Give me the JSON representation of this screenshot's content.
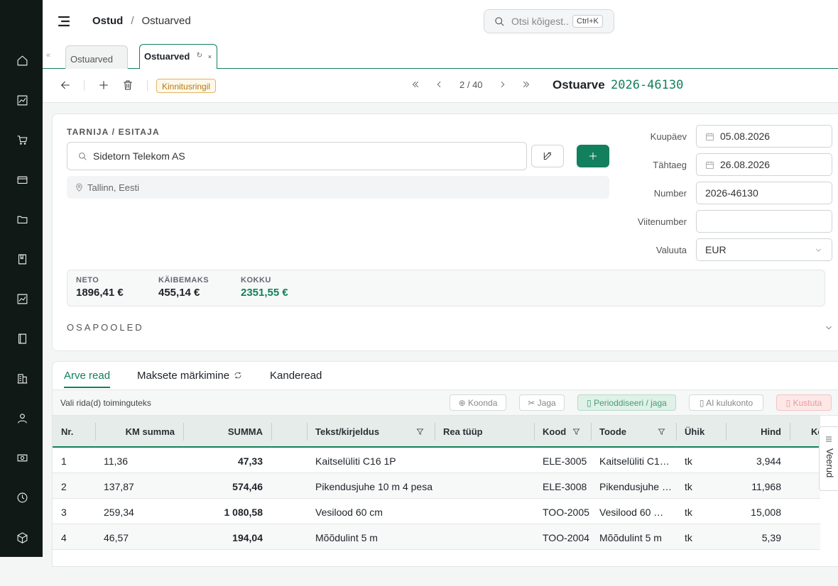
{
  "breadcrumb": {
    "root": "Ostud",
    "separator": "/",
    "current": "Ostuarved"
  },
  "search": {
    "placeholder": "Otsi kõigest...",
    "shortcut": "Ctrl+K"
  },
  "tabs": [
    {
      "label": "Ostuarved",
      "active": false
    },
    {
      "label": "Ostuarved",
      "active": true,
      "close": "×",
      "refresh": "↻"
    }
  ],
  "toolbar": {
    "status": "Kinnitusringil",
    "pager": "2 / 40",
    "doc_label": "Ostuarve",
    "doc_number": "2026-46130"
  },
  "vendor": {
    "section_label": "TARNIJA / ESITAJA",
    "name": "Sidetorn Telekom AS",
    "location": "Tallinn, Eesti"
  },
  "fields": {
    "date_label": "Kuupäev",
    "date": "05.08.2026",
    "due_label": "Tähtaeg",
    "due": "26.08.2026",
    "number_label": "Number",
    "number": "2026-46130",
    "ref_label": "Viitenumber",
    "ref": "",
    "currency_label": "Valuuta",
    "currency": "EUR"
  },
  "totals": {
    "net_label": "NETO",
    "net": "1896,41 €",
    "vat_label": "KÄIBEMAKS",
    "vat": "455,14 €",
    "total_label": "KOKKU",
    "total": "2351,55 €"
  },
  "parties_label": "OSAPOOLED",
  "bottom_tabs": [
    "Arve read",
    "Maksete märkimine",
    "Kanderead"
  ],
  "actions": {
    "hint": "Vali rida(d) toiminguteks",
    "merge": "⊕ Koonda",
    "split": "✂ Jaga",
    "periodize": "▯ Perioddiseeri / jaga",
    "ai": "▯ AI kulukonto",
    "delete": "▯ Kustuta"
  },
  "table": {
    "headers": [
      "Nr.",
      "KM summa",
      "SUMMA",
      "",
      "Tekst/kirjeldus",
      "Rea tüüp",
      "Kood",
      "Toode",
      "Ühik",
      "Hind",
      "Ko"
    ],
    "rows": [
      [
        "1",
        "11,36",
        "47,33",
        "Kaitselüliti C16 1P",
        "",
        "ELE-3005",
        "Kaitselüliti C1…",
        "tk",
        "3,944"
      ],
      [
        "2",
        "137,87",
        "574,46",
        "Pikendusjuhe 10 m 4 pesa",
        "",
        "ELE-3008",
        "Pikendusjuhe …",
        "tk",
        "11,968"
      ],
      [
        "3",
        "259,34",
        "1 080,58",
        "Vesilood 60 cm",
        "",
        "TOO-2005",
        "Vesilood 60 …",
        "tk",
        "15,008"
      ],
      [
        "4",
        "46,57",
        "194,04",
        "Mõõdulint 5 m",
        "",
        "TOO-2004",
        "Mõõdulint 5 m",
        "tk",
        "5,39"
      ]
    ]
  },
  "columns_button": "Veerud",
  "colors": {
    "accent": "#12805c",
    "rail": "#111916",
    "warning": "#b07a18"
  }
}
